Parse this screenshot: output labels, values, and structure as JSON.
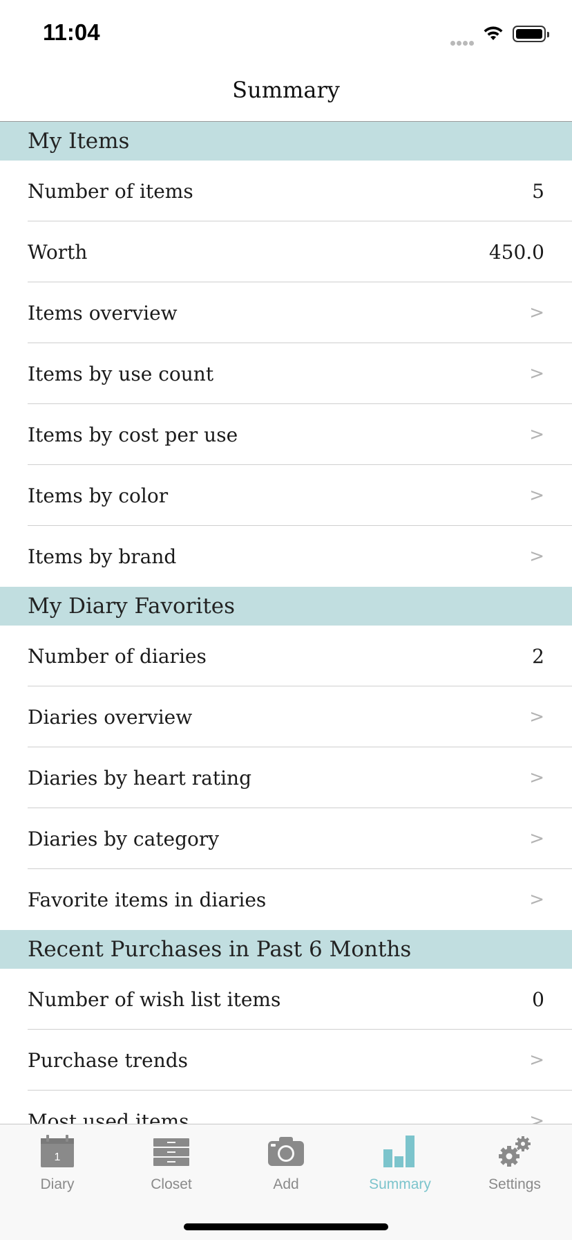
{
  "status_bar": {
    "time": "11:04"
  },
  "navbar": {
    "title": "Summary"
  },
  "sections": {
    "my_items": {
      "title": "My Items",
      "number_of_items": {
        "label": "Number of items",
        "value": "5"
      },
      "worth": {
        "label": "Worth",
        "value": "450.0"
      },
      "items_overview": {
        "label": "Items overview",
        "chevron": ">"
      },
      "items_by_use_count": {
        "label": "Items by use count",
        "chevron": ">"
      },
      "items_by_cost_per_use": {
        "label": "Items by cost per use",
        "chevron": ">"
      },
      "items_by_color": {
        "label": "Items by color",
        "chevron": ">"
      },
      "items_by_brand": {
        "label": "Items by brand",
        "chevron": ">"
      }
    },
    "my_diary_favorites": {
      "title": "My Diary Favorites",
      "number_of_diaries": {
        "label": "Number of diaries",
        "value": "2"
      },
      "diaries_overview": {
        "label": "Diaries overview",
        "chevron": ">"
      },
      "diaries_by_heart_rating": {
        "label": "Diaries by heart rating",
        "chevron": ">"
      },
      "diaries_by_category": {
        "label": "Diaries by category",
        "chevron": ">"
      },
      "favorite_items_in_diaries": {
        "label": "Favorite items in diaries",
        "chevron": ">"
      }
    },
    "recent_purchases": {
      "title": "Recent Purchases in Past 6 Months",
      "number_of_wish_list_items": {
        "label": "Number of wish list items",
        "value": "0"
      },
      "purchase_trends": {
        "label": "Purchase trends",
        "chevron": ">"
      },
      "most_used_items": {
        "label": "Most used items",
        "chevron": ">"
      }
    }
  },
  "tab_bar": {
    "diary": {
      "label": "Diary",
      "icon": "calendar-icon",
      "icon_text": "1"
    },
    "closet": {
      "label": "Closet",
      "icon": "dresser-icon"
    },
    "add": {
      "label": "Add",
      "icon": "camera-icon"
    },
    "summary": {
      "label": "Summary",
      "icon": "bar-chart-icon",
      "active": true
    },
    "settings": {
      "label": "Settings",
      "icon": "gears-icon"
    }
  },
  "colors": {
    "section_header_bg": "#c1dee0",
    "tab_active": "#7cc4cc",
    "tab_inactive": "#8a8a8a",
    "chevron": "#b3b3b3"
  }
}
